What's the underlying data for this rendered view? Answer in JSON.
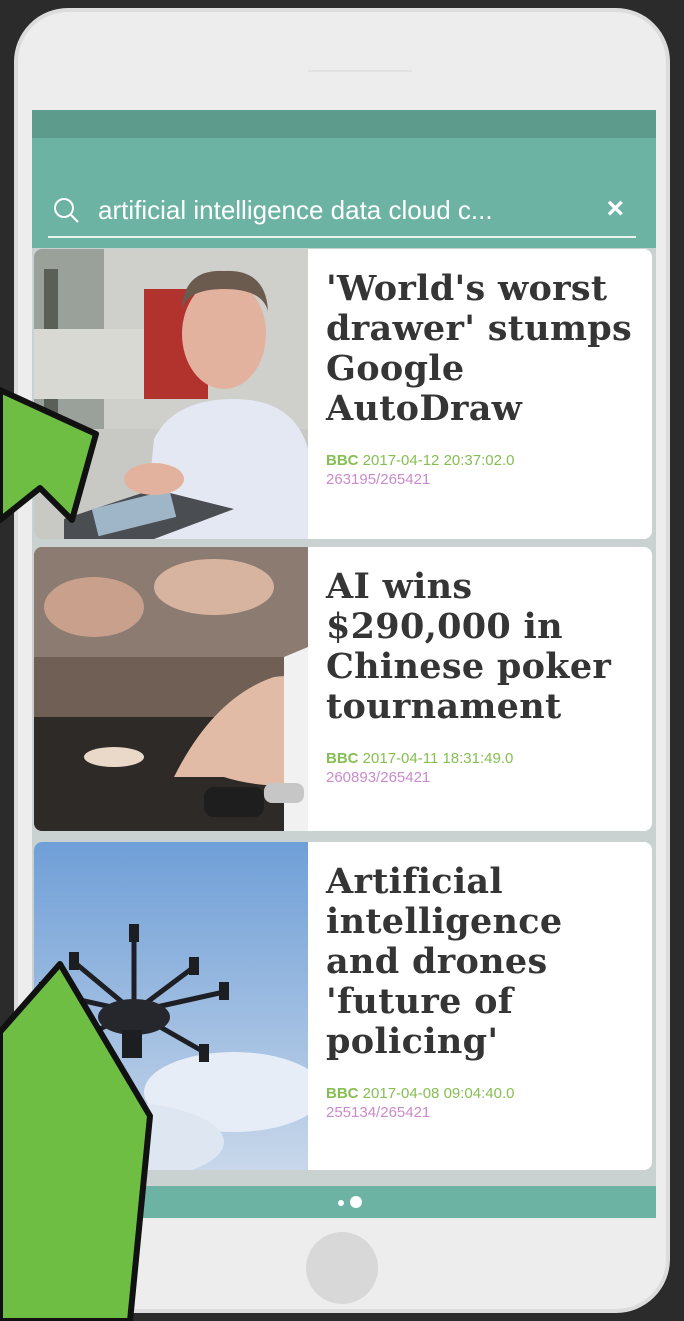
{
  "search": {
    "query": "artificial intelligence data cloud c...",
    "search_icon": "search-icon",
    "clear_icon": "close-icon",
    "clear_label": "×"
  },
  "articles": [
    {
      "title": "'World's worst drawer' stumps Google AutoDraw",
      "source": "BBC",
      "date": "2017-04-12 20:37:02.0",
      "count": "263195/265421"
    },
    {
      "title": "AI wins $290,000 in Chinese poker tournament",
      "source": "BBC",
      "date": "2017-04-11 18:31:49.0",
      "count": "260893/265421"
    },
    {
      "title": "Artificial intelligence and drones 'future of policing'",
      "source": "BBC",
      "date": "2017-04-08 09:04:40.0",
      "count": "255134/265421"
    }
  ],
  "colors": {
    "accent": "#6cb3a4",
    "status_bar": "#5d9b8d",
    "source": "#86be52",
    "count": "#c98bc9",
    "annotation_arrow": "#6fbe44"
  }
}
